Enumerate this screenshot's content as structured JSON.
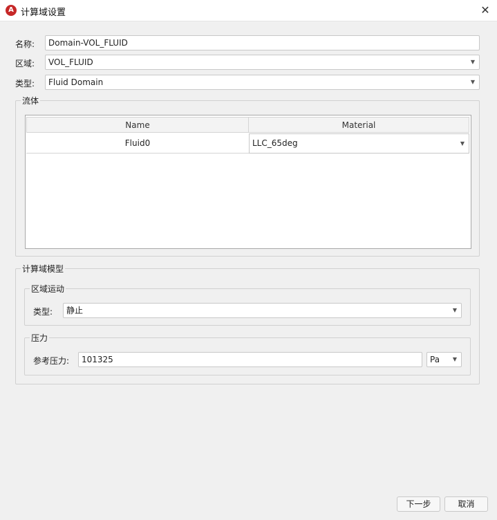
{
  "window": {
    "title": "计算域设置",
    "app_icon_glyph": "A",
    "close_glyph": "✕"
  },
  "form": {
    "name_label": "名称:",
    "name_value": "Domain-VOL_FLUID",
    "region_label": "区域:",
    "region_value": "VOL_FLUID",
    "type_label": "类型:",
    "type_value": "Fluid Domain"
  },
  "fluid_group": {
    "title": "流体",
    "columns": [
      "Name",
      "Material"
    ],
    "rows": [
      {
        "name": "Fluid0",
        "material": "LLC_65deg"
      }
    ]
  },
  "domain_model": {
    "title": "计算域模型",
    "motion": {
      "title": "区域运动",
      "type_label": "类型:",
      "type_value": "静止"
    },
    "pressure": {
      "title": "压力",
      "ref_label": "参考压力:",
      "ref_value": "101325",
      "unit": "Pa"
    }
  },
  "footer": {
    "next_label": "下一步",
    "cancel_label": "取消"
  },
  "dropdown_glyph": "▼"
}
